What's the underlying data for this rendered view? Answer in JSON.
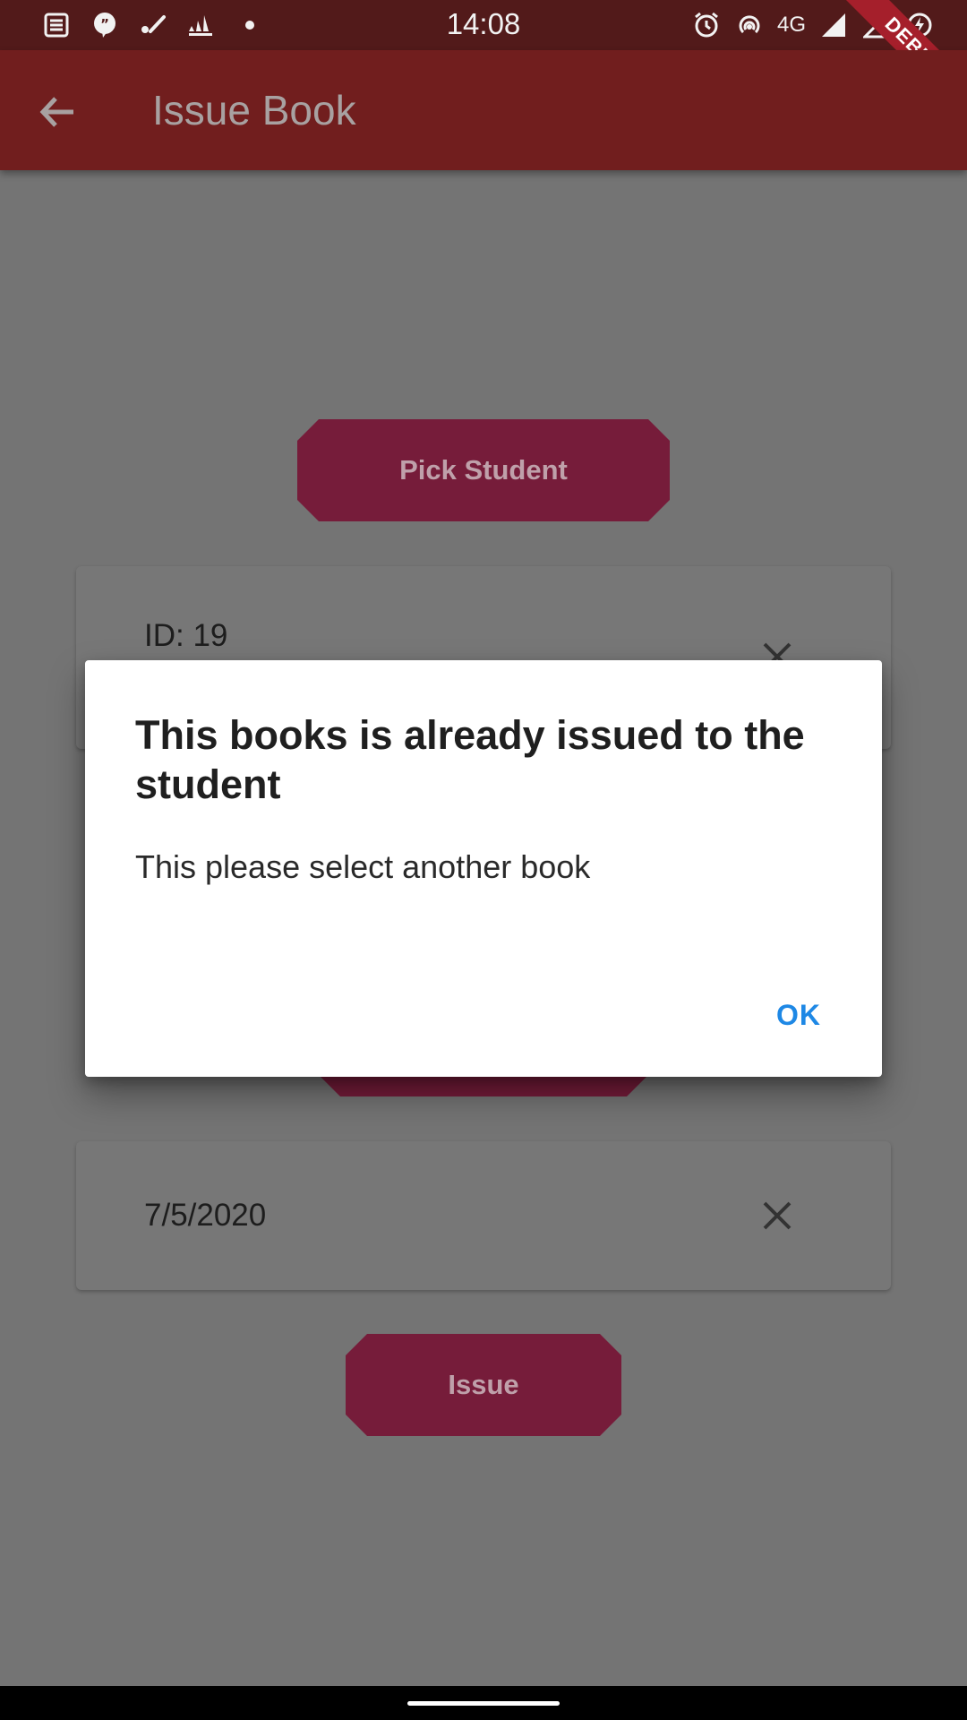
{
  "status_bar": {
    "time": "14:08",
    "network": "4G",
    "debug_label": "DEBUG",
    "left_icons": [
      "news-icon",
      "quote-icon",
      "brush-icon",
      "adidas-icon",
      "dot-icon"
    ],
    "right_icons": [
      "alarm-icon",
      "hotspot-icon",
      "signal-icon",
      "signal-empty-icon",
      "data-saver-icon"
    ]
  },
  "app_bar": {
    "title": "Issue Book",
    "back_icon": "arrow-back-icon"
  },
  "content": {
    "pick_student_label": "Pick Student",
    "student_card": {
      "text": "ID: 19"
    },
    "date_card": {
      "text": "7/5/2020"
    },
    "issue_label": "Issue"
  },
  "dialog": {
    "title": "This books is already issued to the student",
    "message": "This please select another book",
    "ok_label": "OK"
  },
  "colors": {
    "status_bar": "#521a1a",
    "app_bar": "#711e1e",
    "button": "#761c3a",
    "scrim_background": "#747474",
    "dialog_action": "#1e88e5"
  }
}
